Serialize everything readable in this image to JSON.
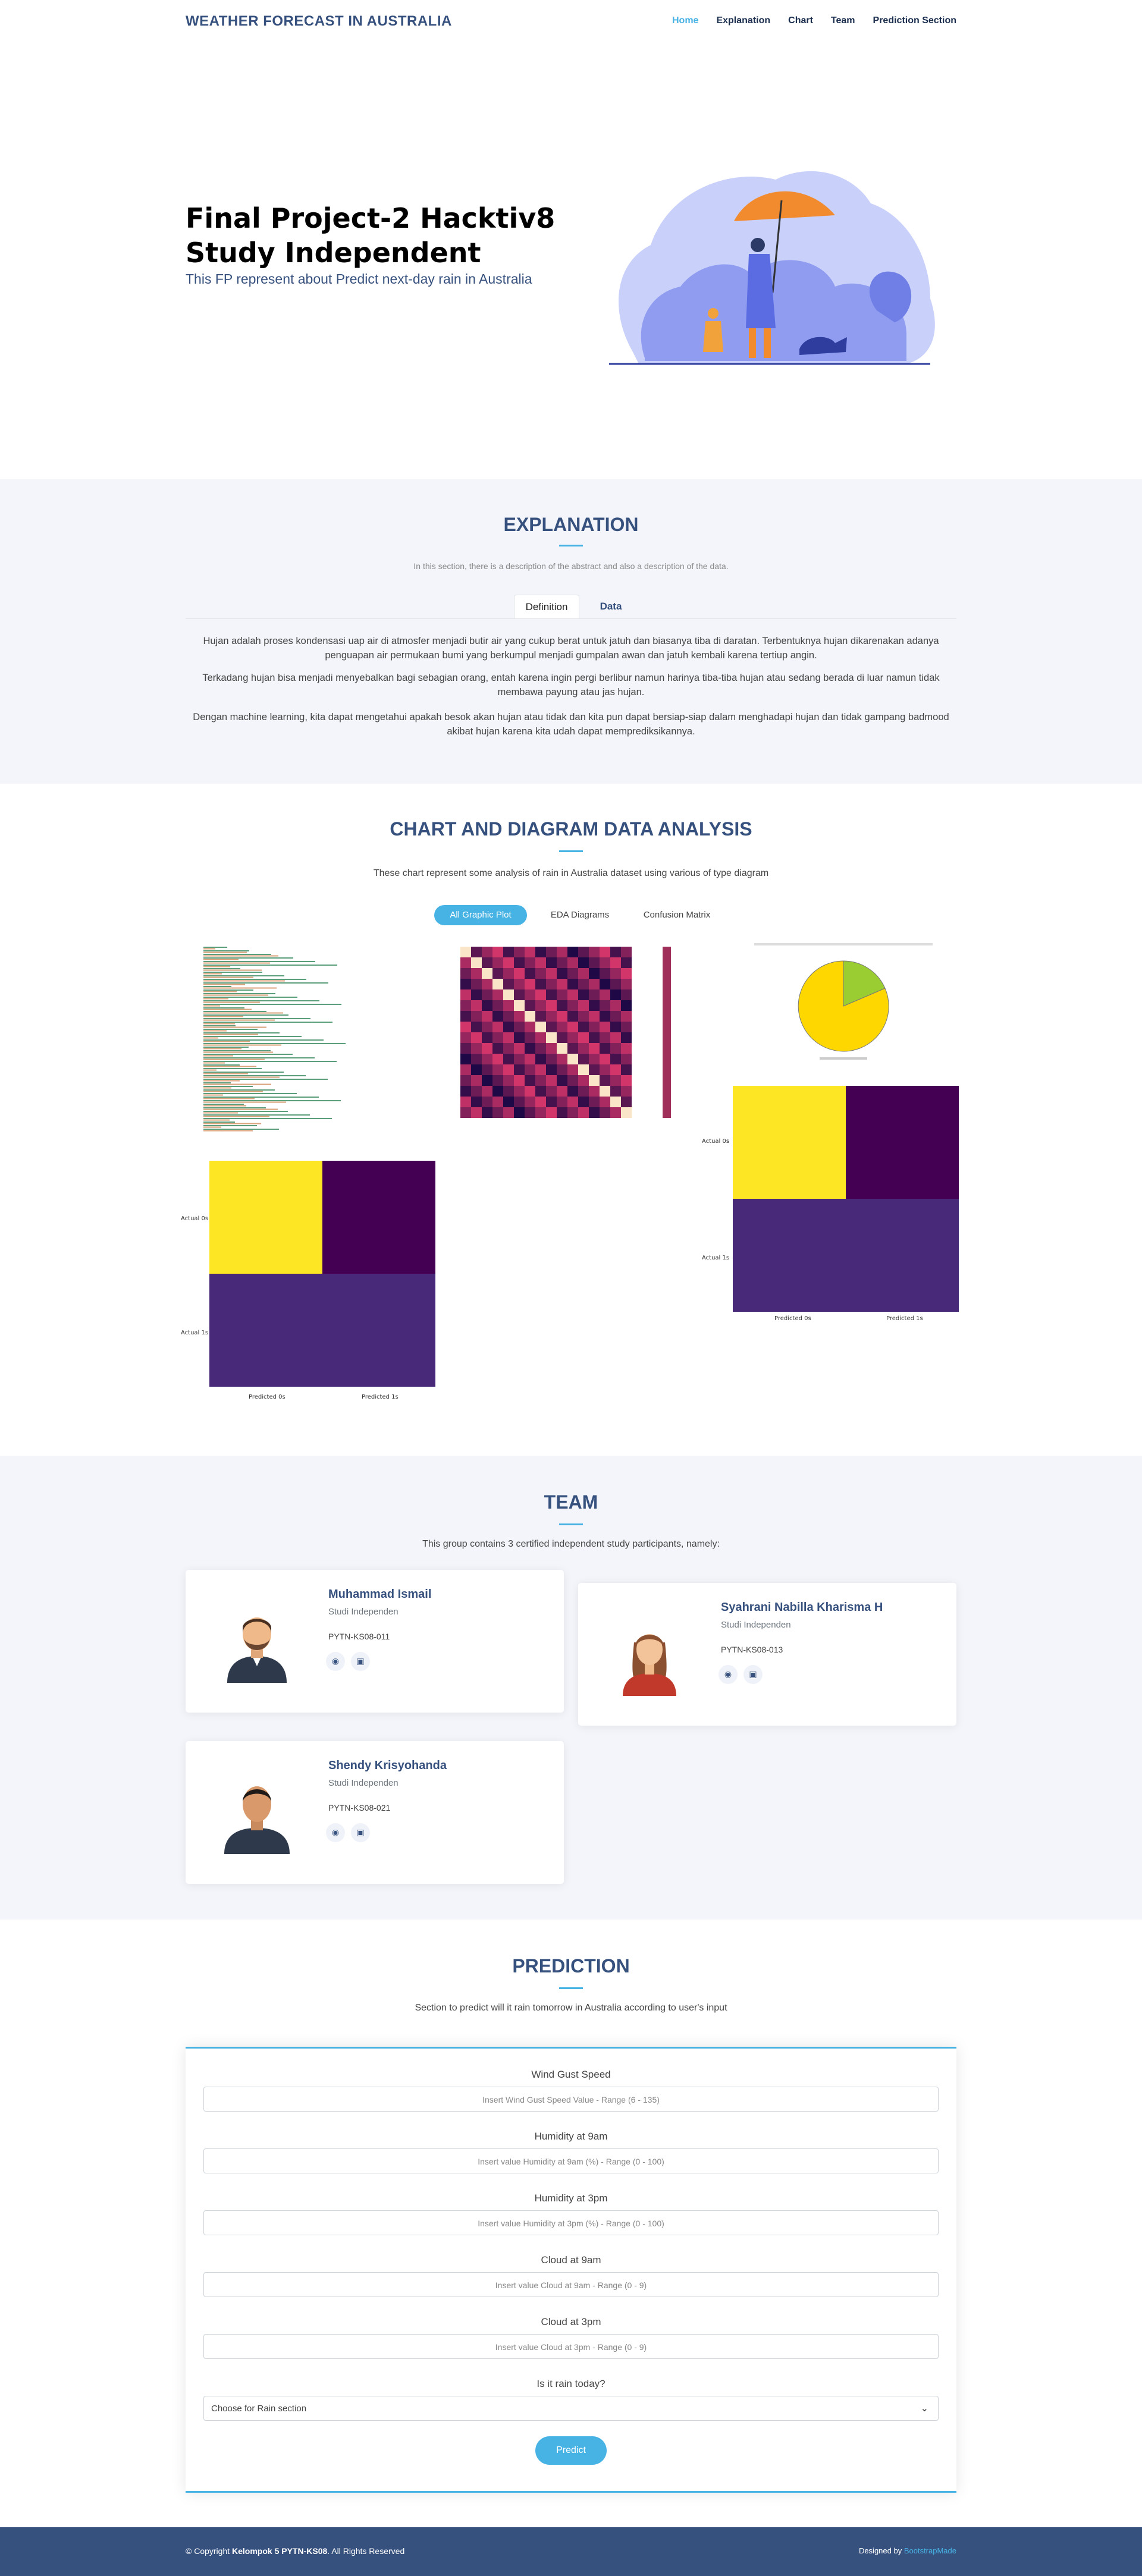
{
  "header": {
    "logo": "WEATHER FORECAST IN AUSTRALIA",
    "nav": [
      "Home",
      "Explanation",
      "Chart",
      "Team",
      "Prediction Section"
    ],
    "active_nav": "Home"
  },
  "hero": {
    "title": "Final Project-2 Hacktiv8 Study Independent",
    "subtitle": "This FP represent about Predict next-day rain in Australia"
  },
  "explanation": {
    "title": "EXPLANATION",
    "description": "In this section, there is a description of the abstract and also a description of the data.",
    "tabs": [
      "Definition",
      "Data"
    ],
    "paragraphs": [
      "Hujan adalah proses kondensasi uap air di atmosfer menjadi butir air yang cukup berat untuk jatuh dan biasanya tiba di daratan. Terbentuknya hujan dikarenakan adanya penguapan air permukaan bumi yang berkumpul menjadi gumpalan awan dan jatuh kembali karena tertiup angin.",
      "Terkadang hujan bisa menjadi menyebalkan bagi sebagian orang, entah karena ingin pergi berlibur namun harinya tiba-tiba hujan atau sedang berada di luar namun tidak membawa payung atau jas hujan.",
      "Dengan machine learning, kita dapat mengetahui apakah besok akan hujan atau tidak dan kita pun dapat bersiap-siap dalam menghadapi hujan dan tidak gampang badmood akibat hujan karena kita udah dapat memprediksikannya."
    ]
  },
  "chart": {
    "title": "CHART AND DIAGRAM DATA ANALYSIS",
    "description": "These chart represent some analysis of rain in Australia dataset using various of type diagram",
    "filters": [
      "All Graphic Plot",
      "EDA Diagrams",
      "Confusion Matrix"
    ],
    "confusion_labels": {
      "actual": [
        "Actual 0s",
        "Actual 1s"
      ],
      "predicted": [
        "Predicted 0s",
        "Predicted 1s"
      ]
    },
    "colors": {
      "accent": "#47b2e4",
      "yellow": "#fde725",
      "purple_dark": "#440154",
      "purple": "#482878",
      "pie_yellow": "#ffd700",
      "pie_green": "#9acd32"
    }
  },
  "team": {
    "title": "TEAM",
    "description": "This group contains 3 certified independent study participants, namely:",
    "members": [
      {
        "name": "Muhammad Ismail",
        "role": "Studi Independen",
        "id": "PYTN-KS08-011"
      },
      {
        "name": "Syahrani Nabilla Kharisma H",
        "role": "Studi Independen",
        "id": "PYTN-KS08-013"
      },
      {
        "name": "Shendy Krisyohanda",
        "role": "Studi Independen",
        "id": "PYTN-KS08-021"
      }
    ]
  },
  "prediction": {
    "title": "PREDICTION",
    "description": "Section to predict will it rain tomorrow in Australia according to user's input",
    "fields": [
      {
        "label": "Wind Gust Speed",
        "placeholder": "Insert Wind Gust Speed Value - Range (6 - 135)"
      },
      {
        "label": "Humidity at 9am",
        "placeholder": "Insert value Humidity at 9am (%) - Range (0 - 100)"
      },
      {
        "label": "Humidity at 3pm",
        "placeholder": "Insert value Humidity at 3pm (%) - Range (0 - 100)"
      },
      {
        "label": "Cloud at 9am",
        "placeholder": "Insert value Cloud at 9am - Range (0 - 9)"
      },
      {
        "label": "Cloud at 3pm",
        "placeholder": "Insert value Cloud at 3pm - Range (0 - 9)"
      }
    ],
    "select_label": "Is it rain today?",
    "select_value": "Choose for Rain section",
    "button": "Predict"
  },
  "footer": {
    "copyright_prefix": "© Copyright ",
    "copyright_bold": "Kelompok 5 PYTN-KS08",
    "copyright_suffix": ". All Rights Reserved",
    "designed_prefix": "Designed by ",
    "designed_link": "BootstrapMade"
  }
}
